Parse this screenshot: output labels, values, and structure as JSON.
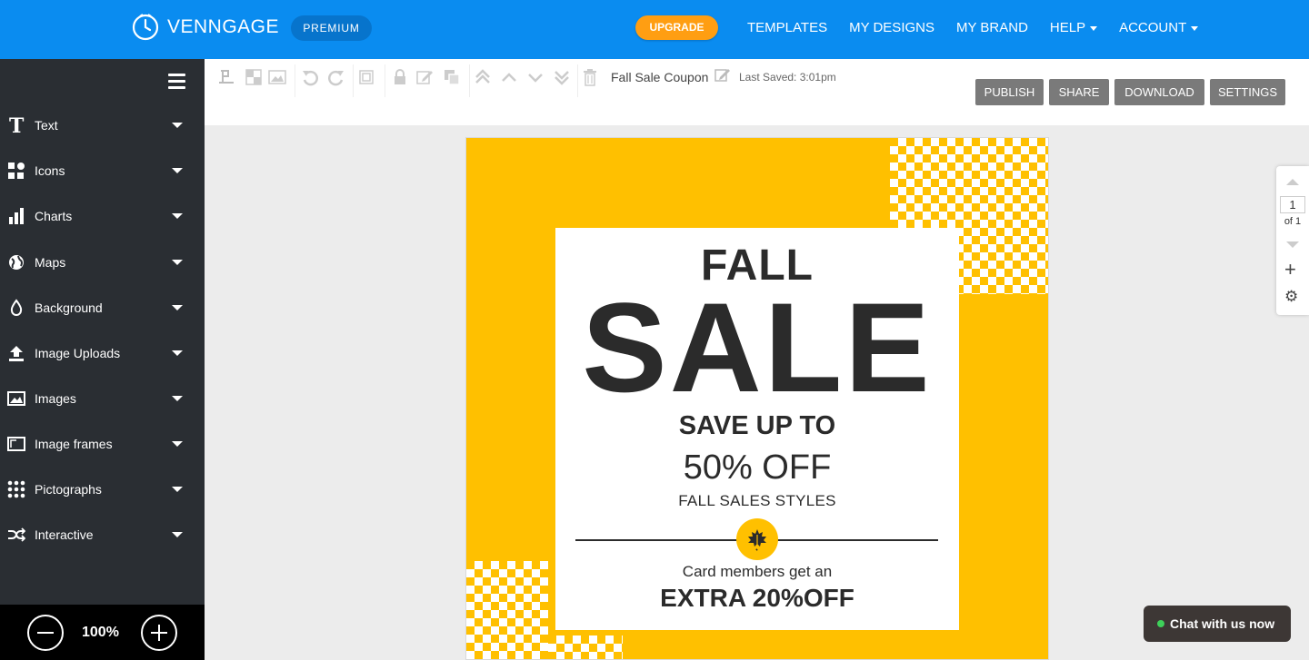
{
  "app": {
    "logo_text": "VENNGAGE",
    "plan_badge": "PREMIUM",
    "upgrade_label": "UPGRADE",
    "brand_color": "#0a8cf0"
  },
  "nav": {
    "templates": "TEMPLATES",
    "my_designs": "MY DESIGNS",
    "my_brand": "MY BRAND",
    "help": "HELP",
    "account": "ACCOUNT"
  },
  "sidebar": {
    "items": [
      {
        "label": "Text",
        "icon": "text-icon"
      },
      {
        "label": "Icons",
        "icon": "shapes-icon"
      },
      {
        "label": "Charts",
        "icon": "bar-chart-icon"
      },
      {
        "label": "Maps",
        "icon": "globe-icon"
      },
      {
        "label": "Background",
        "icon": "droplet-icon"
      },
      {
        "label": "Image Uploads",
        "icon": "upload-icon"
      },
      {
        "label": "Images",
        "icon": "image-icon"
      },
      {
        "label": "Image frames",
        "icon": "frame-icon"
      },
      {
        "label": "Pictographs",
        "icon": "grid-dots-icon"
      },
      {
        "label": "Interactive",
        "icon": "shuffle-icon"
      }
    ],
    "zoom_level": "100%"
  },
  "toolbar": {
    "document_title": "Fall Sale Coupon",
    "last_saved": "Last Saved: 3:01pm",
    "publish": "PUBLISH",
    "share": "SHARE",
    "download": "DOWNLOAD",
    "settings": "SETTINGS"
  },
  "design": {
    "headline": "FALL",
    "title": "SALE",
    "save_text": "SAVE UP TO",
    "discount": "50% OFF",
    "styles_text": "FALL SALES STYLES",
    "members_text": "Card members get an",
    "extra_text": "EXTRA 20%OFF",
    "background_color": "#ffc000",
    "text_color": "#2b2b2b"
  },
  "page_nav": {
    "current_page": "1",
    "total_label": "of 1"
  },
  "chat": {
    "label": "Chat with us now"
  }
}
